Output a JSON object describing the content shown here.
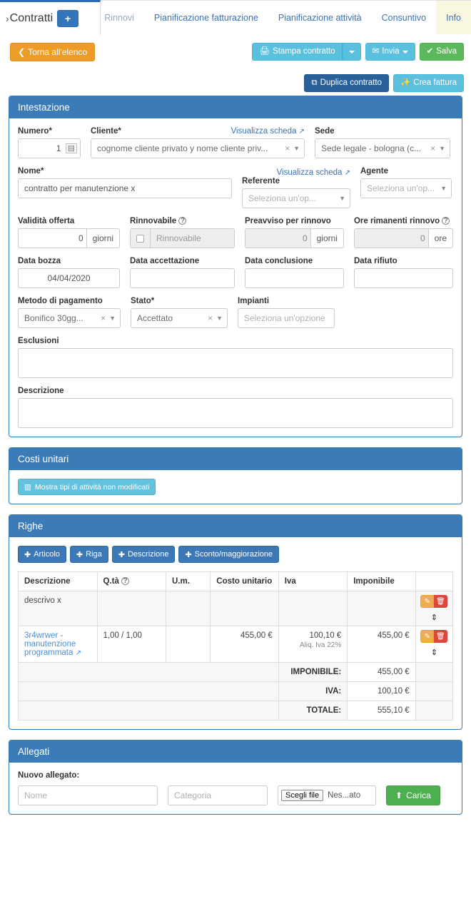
{
  "breadcrumb": {
    "chevron": "›",
    "title": "Contratti",
    "add_label": "+"
  },
  "tabs": [
    {
      "label": "Rinnovi",
      "state": "muted"
    },
    {
      "label": "Pianificazione fatturazione",
      "state": "link"
    },
    {
      "label": "Pianificazione attività",
      "state": "link"
    },
    {
      "label": "Consuntivo",
      "state": "link"
    },
    {
      "label": "Info",
      "state": "active"
    }
  ],
  "actions": {
    "back": "Torna all'elenco",
    "print": "Stampa contratto",
    "send": "Invia",
    "save": "Salva",
    "duplicate": "Duplica contratto",
    "create_invoice": "Crea fattura"
  },
  "intestazione": {
    "title": "Intestazione",
    "numero_label": "Numero*",
    "numero_value": "1",
    "cliente_label": "Cliente*",
    "cliente_value": "cognome cliente privato y nome cliente priv...",
    "visualizza_scheda": "Visualizza scheda",
    "sede_label": "Sede",
    "sede_value": "Sede legale - bologna (c...",
    "nome_label": "Nome*",
    "nome_value": "contratto per manutenzione x",
    "visualizza_scheda2": "Visualizza scheda",
    "referente_label": "Referente",
    "referente_placeholder": "Seleziona un'op...",
    "agente_label": "Agente",
    "agente_placeholder": "Seleziona un'op...",
    "validita_label": "Validità offerta",
    "validita_value": "0",
    "validita_addon": "giorni",
    "rinnovabile_label": "Rinnovabile",
    "rinnovabile_text": "Rinnovabile",
    "preavviso_label": "Preavviso per rinnovo",
    "preavviso_value": "0",
    "preavviso_addon": "giorni",
    "ore_label": "Ore rimanenti rinnovo",
    "ore_value": "0",
    "ore_addon": "ore",
    "data_bozza_label": "Data bozza",
    "data_bozza_value": "04/04/2020",
    "data_accettazione_label": "Data accettazione",
    "data_accettazione_value": "",
    "data_conclusione_label": "Data conclusione",
    "data_conclusione_value": "",
    "data_rifiuto_label": "Data rifiuto",
    "data_rifiuto_value": "",
    "metodo_label": "Metodo di pagamento",
    "metodo_value": "Bonifico 30gg...",
    "stato_label": "Stato*",
    "stato_value": "Accettato",
    "impianti_label": "Impianti",
    "impianti_placeholder": "Seleziona un'opzione",
    "esclusioni_label": "Esclusioni",
    "esclusioni_value": "",
    "descrizione_label": "Descrizione",
    "descrizione_value": ""
  },
  "costi_unitari": {
    "title": "Costi unitari",
    "mostra_label": "Mostra tipi di attività non modificati"
  },
  "righe": {
    "title": "Righe",
    "buttons": [
      {
        "label": "Articolo"
      },
      {
        "label": "Riga"
      },
      {
        "label": "Descrizione"
      },
      {
        "label": "Sconto/maggiorazione"
      }
    ],
    "headers": [
      "Descrizione",
      "Q.tà",
      "U.m.",
      "Costo unitario",
      "Iva",
      "Imponibile",
      ""
    ],
    "rows": [
      {
        "descrizione": "descrivo x",
        "is_link": false,
        "qta": "",
        "um": "",
        "costo": "",
        "iva": "",
        "iva_sub": "",
        "imponibile": ""
      },
      {
        "descrizione": "3r4wrwer - manutenzione programmata",
        "is_link": true,
        "qta": "1,00 / 1,00",
        "um": "",
        "costo": "455,00 €",
        "iva": "100,10 €",
        "iva_sub": "Aliq. Iva 22%",
        "imponibile": "455,00 €"
      }
    ],
    "totals": [
      {
        "label": "IMPONIBILE:",
        "value": "455,00 €"
      },
      {
        "label": "IVA:",
        "value": "100,10 €"
      },
      {
        "label": "TOTALE:",
        "value": "555,10 €"
      }
    ]
  },
  "allegati": {
    "title": "Allegati",
    "nuovo_label": "Nuovo allegato:",
    "nome_placeholder": "Nome",
    "categoria_placeholder": "Categoria",
    "file_button": "Scegli file",
    "file_status": "Nes...ato",
    "carica_label": "Carica"
  },
  "colors": {
    "panel_header": "#3b7bb8",
    "primary": "#3b78b5",
    "orange": "#ed9c28",
    "cyan": "#5bc0de",
    "green": "#5cb85c",
    "navy": "#2a6099",
    "danger": "#e2453b",
    "tab_active_bg": "#faf7e0"
  }
}
